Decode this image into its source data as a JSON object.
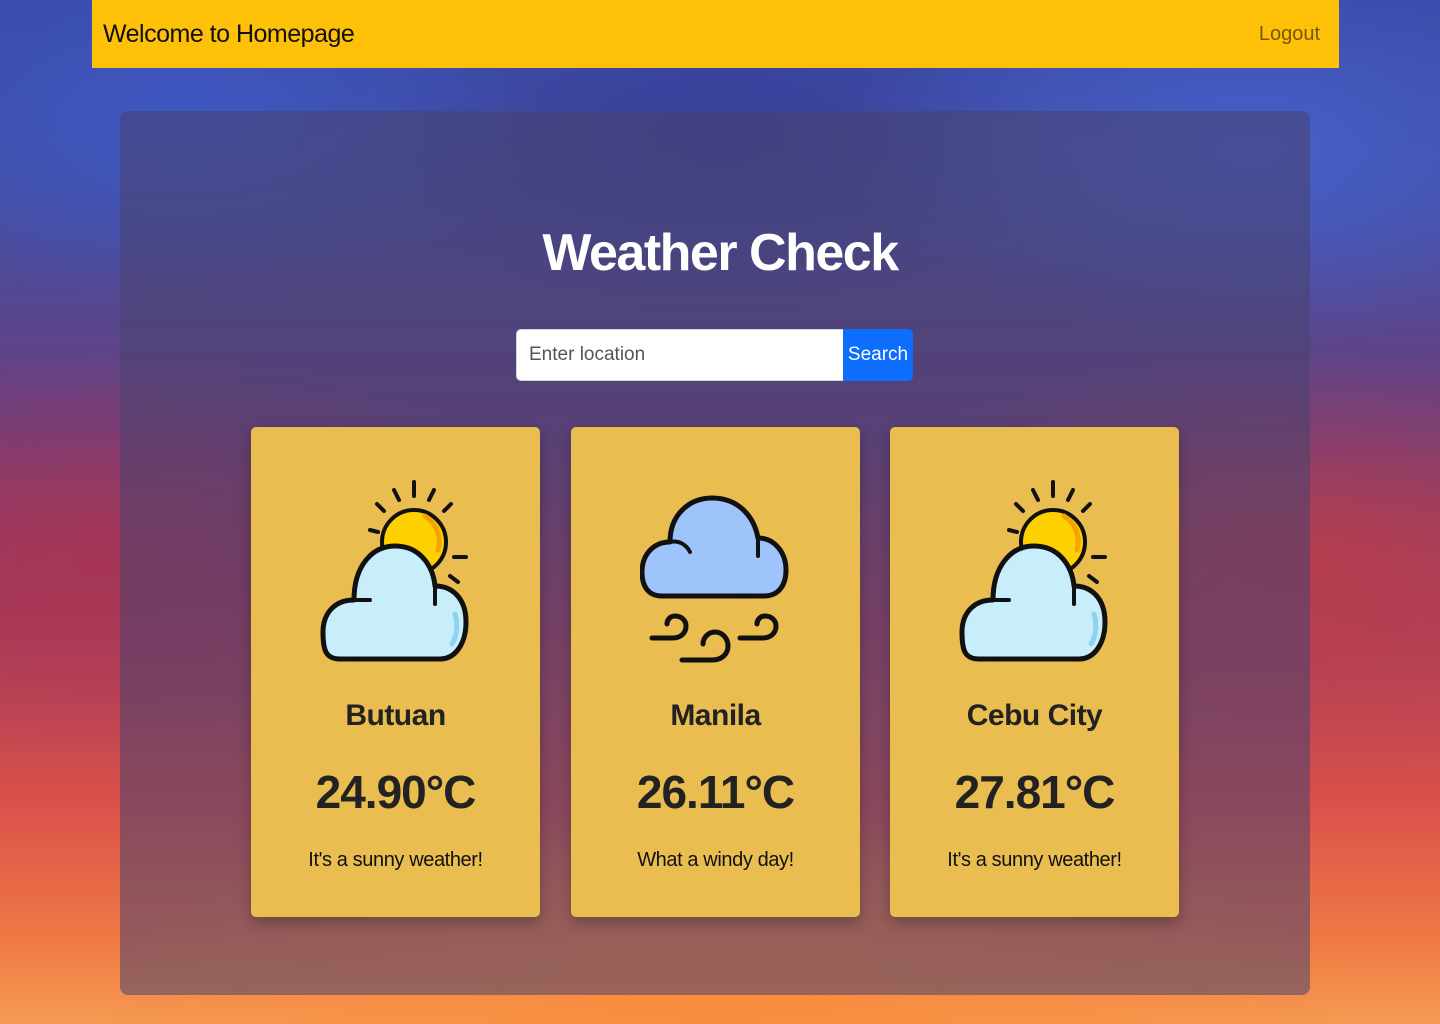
{
  "navbar": {
    "brand": "Welcome to Homepage",
    "logout": "Logout"
  },
  "main": {
    "title": "Weather Check",
    "search": {
      "placeholder": "Enter location",
      "button": "Search"
    },
    "cards": [
      {
        "city": "Butuan",
        "temperature": "24.90°C",
        "description": "It's a sunny weather!",
        "icon": "sun-behind-cloud-icon"
      },
      {
        "city": "Manila",
        "temperature": "26.11°C",
        "description": "What a windy day!",
        "icon": "windy-cloud-icon"
      },
      {
        "city": "Cebu City",
        "temperature": "27.81°C",
        "description": "It's a sunny weather!",
        "icon": "sun-behind-cloud-icon"
      }
    ]
  },
  "colors": {
    "navbar": "#ffc107",
    "card": "#e9bd4f",
    "button": "#0d6efd",
    "sun": "#ffd000",
    "cloud_light": "#c8eefc",
    "cloud_blue": "#9ec4fb"
  }
}
